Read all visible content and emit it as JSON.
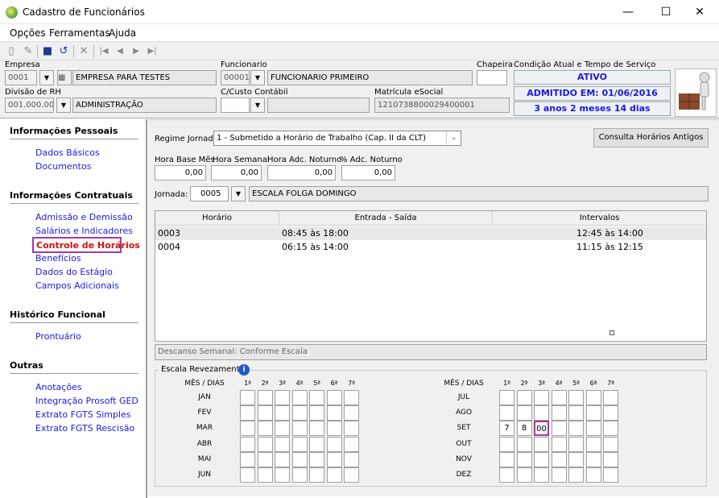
{
  "window": {
    "title": "Cadastro de Funcionários",
    "minimize": "—",
    "maximize": "☐",
    "close": "✕"
  },
  "menu": [
    "Opções",
    "Ferramentas",
    "Ajuda"
  ],
  "header": {
    "empresa_label": "Empresa",
    "empresa_code": "0001",
    "empresa_name": "EMPRESA PARA TESTES",
    "funcionario_label": "Funcionario",
    "funcionario_code": "00001",
    "funcionario_name": "FUNCIONARIO PRIMEIRO",
    "chapeira_label": "Chapeira",
    "chapeira_value": "",
    "divisao_label": "Divisão de RH",
    "divisao_code": "001.000.000",
    "divisao_name": "ADMINISTRAÇÃO",
    "ccusto_label": "C/Custo Contábil",
    "ccusto_code": "",
    "ccusto_name": "",
    "matricula_label": "Matrícula eSocial",
    "matricula_value": "1210738800029400001",
    "condicao_label": "Condição Atual e Tempo de Serviço",
    "status": "ATIVO",
    "admitido": "ADMITIDO EM: 01/06/2016",
    "tempo": "3 anos 2 meses 14 dias"
  },
  "sidebar": {
    "sec1": "Informações Pessoais",
    "sec1_items": [
      "Dados Básicos",
      "Documentos"
    ],
    "sec2": "Informações Contratuais",
    "sec2_items": [
      "Admissão e Demissão",
      "Salários e Indicadores",
      "Controle de Horários",
      "Benefícios",
      "Dados do Estágio",
      "Campos Adicionais"
    ],
    "sec3": "Histórico Funcional",
    "sec3_items": [
      "Prontuário"
    ],
    "sec4": "Outras",
    "sec4_items": [
      "Anotações",
      "Integração Prosoft GED",
      "Extrato FGTS Simples",
      "Extrato FGTS Rescisão"
    ]
  },
  "main": {
    "regime_label": "Regime Jornada",
    "regime_value": "1 - Submetido a Horário de Trabalho (Cap. II da CLT)",
    "consulta_button": "Consulta Horários Antigos",
    "hora_base_label": "Hora Base Mês",
    "hora_base_value": "0,00",
    "hora_semanal_label": "Hora Semanal",
    "hora_semanal_value": "0,00",
    "hora_adc_label": "Hora Adc. Noturno",
    "hora_adc_value": "0,00",
    "pct_adc_label": "% Adc. Noturno",
    "pct_adc_value": "0,00",
    "jornada_label": "Jornada:",
    "jornada_code": "0005",
    "jornada_name": "ESCALA FOLGA DOMINGO",
    "grid_headers": [
      "Horário",
      "Entrada - Saída",
      "Intervalos"
    ],
    "grid_rows": [
      {
        "horario": "0003",
        "entrada": "08:45 às 18:00",
        "intervalo": "12:45 às 14:00"
      },
      {
        "horario": "0004",
        "entrada": "06:15 às 14:00",
        "intervalo": "11:15 às 12:15"
      }
    ],
    "descanso": "Descanso Semanal: Conforme Escala",
    "escala_title": "Escala Revezamento",
    "mes_dias": "MÊS / DIAS",
    "day_headers": [
      "1ª",
      "2ª",
      "3ª",
      "4ª",
      "5ª",
      "6ª",
      "7ª"
    ],
    "months_left": [
      "JAN",
      "FEV",
      "MAR",
      "ABR",
      "MAI",
      "JUN"
    ],
    "months_right": [
      "JUL",
      "AGO",
      "SET",
      "OUT",
      "NOV",
      "DEZ"
    ],
    "set_values": [
      "7",
      "8",
      "00"
    ]
  },
  "colors": {
    "link": "#1a1adf",
    "selected": "#d21010",
    "highlight": "#a23aa2",
    "status": "#1a1adf"
  }
}
